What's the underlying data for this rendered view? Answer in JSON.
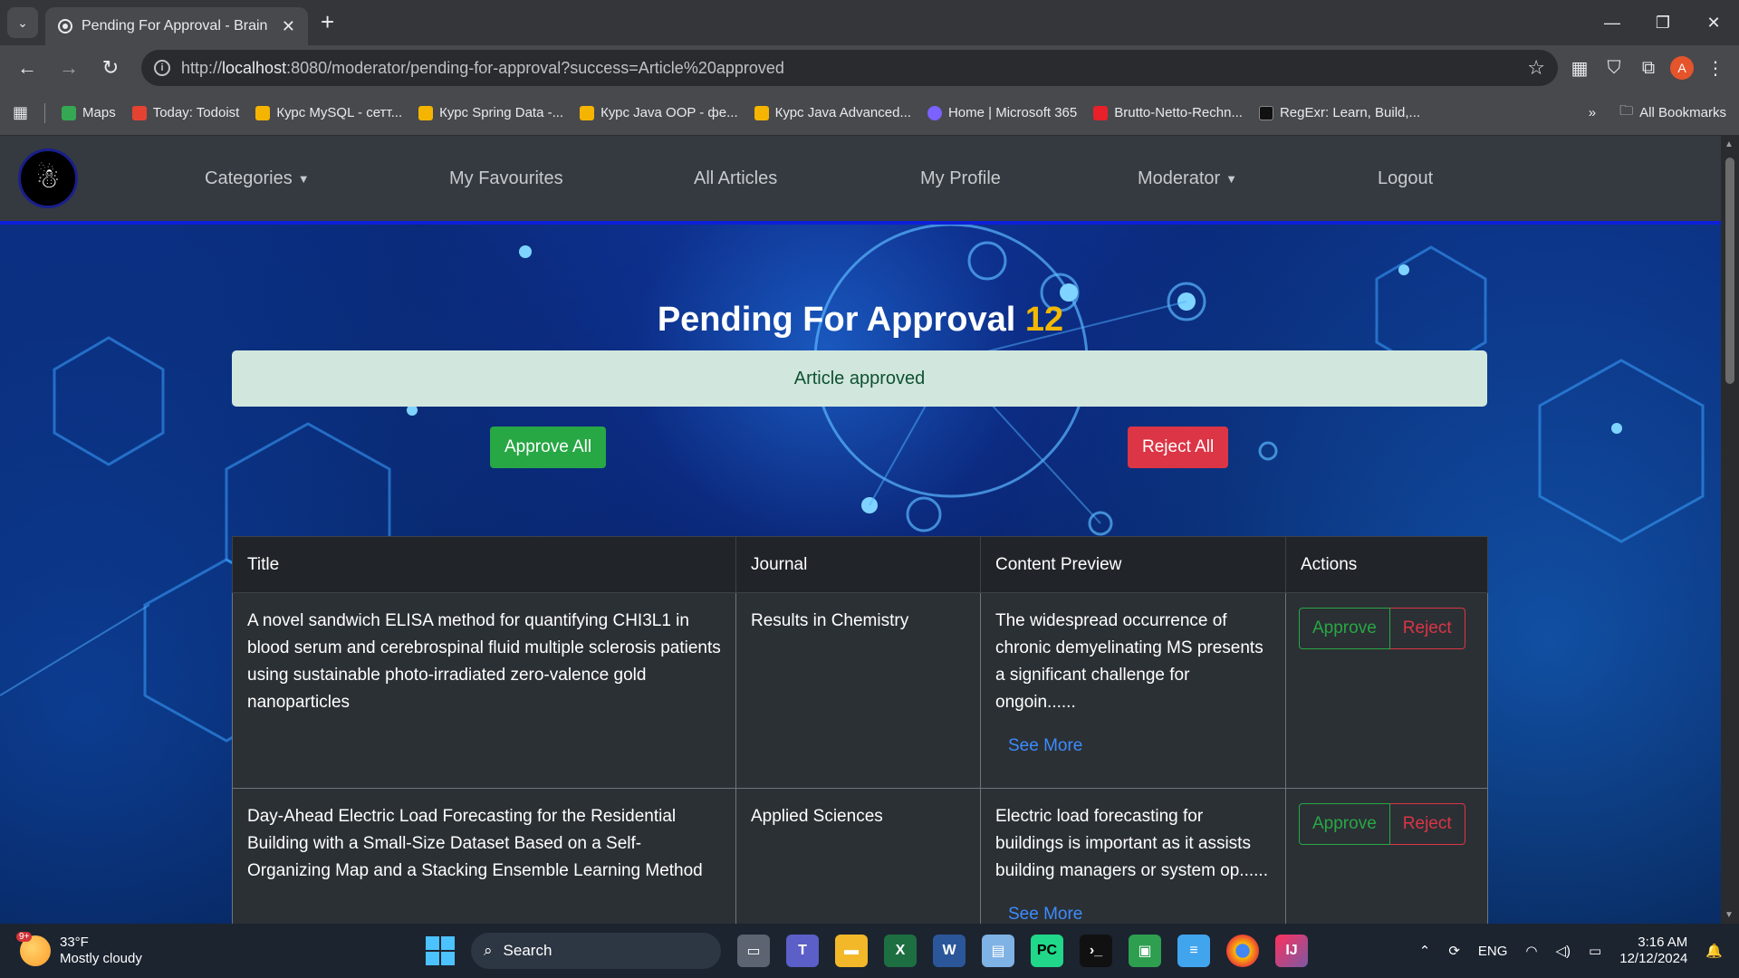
{
  "browser": {
    "tab_title": "Pending For Approval - Brain D",
    "url_prefix": "http://",
    "url_host": "localhost",
    "url_rest": ":8080/moderator/pending-for-approval?success=Article%20approved",
    "bookmarks": [
      {
        "label": "Maps",
        "color": "#34a853"
      },
      {
        "label": "Today: Todoist",
        "color": "#e44332"
      },
      {
        "label": "Курс MySQL - сетт...",
        "color": "#f4b400"
      },
      {
        "label": "Курс Spring Data -...",
        "color": "#f4b400"
      },
      {
        "label": "Курс Java OOP - фе...",
        "color": "#f4b400"
      },
      {
        "label": "Курс Java Advanced...",
        "color": "#f4b400"
      },
      {
        "label": "Home | Microsoft 365",
        "color": "#7b61ff"
      },
      {
        "label": "Brutto-Netto-Rechn...",
        "color": "#e8202a"
      },
      {
        "label": "RegExr: Learn, Build,...",
        "color": "#111111"
      }
    ],
    "all_bookmarks": "All Bookmarks",
    "avatar_letter": "A"
  },
  "nav": {
    "categories": "Categories",
    "favourites": "My Favourites",
    "all_articles": "All Articles",
    "profile": "My Profile",
    "moderator": "Moderator",
    "logout": "Logout"
  },
  "page": {
    "title": "Pending For Approval",
    "count": "12",
    "alert": "Article approved",
    "approve_all": "Approve All",
    "reject_all": "Reject All"
  },
  "table": {
    "headers": [
      "Title",
      "Journal",
      "Content Preview",
      "Actions"
    ],
    "rows": [
      {
        "title": "A novel sandwich ELISA method for quantifying CHI3L1 in blood serum and cerebrospinal fluid multiple sclerosis patients using sustainable photo-irradiated zero-valence gold nanoparticles",
        "journal": "Results in Chemistry",
        "preview": "The widespread occurrence of chronic demyelinating MS presents a significant challenge for ongoin......",
        "see_more": "See More",
        "approve": "Approve",
        "reject": "Reject"
      },
      {
        "title": "Day-Ahead Electric Load Forecasting for the Residential Building with a Small-Size Dataset Based on a Self-Organizing Map and a Stacking Ensemble Learning Method",
        "journal": "Applied Sciences",
        "preview": "Electric load forecasting for buildings is important as it assists building managers or system op......",
        "see_more": "See More",
        "approve": "Approve",
        "reject": "Reject"
      }
    ]
  },
  "taskbar": {
    "weather_temp": "33°F",
    "weather_desc": "Mostly cloudy",
    "weather_badge": "9+",
    "search": "Search",
    "lang": "ENG",
    "time": "3:16 AM",
    "date": "12/12/2024"
  }
}
